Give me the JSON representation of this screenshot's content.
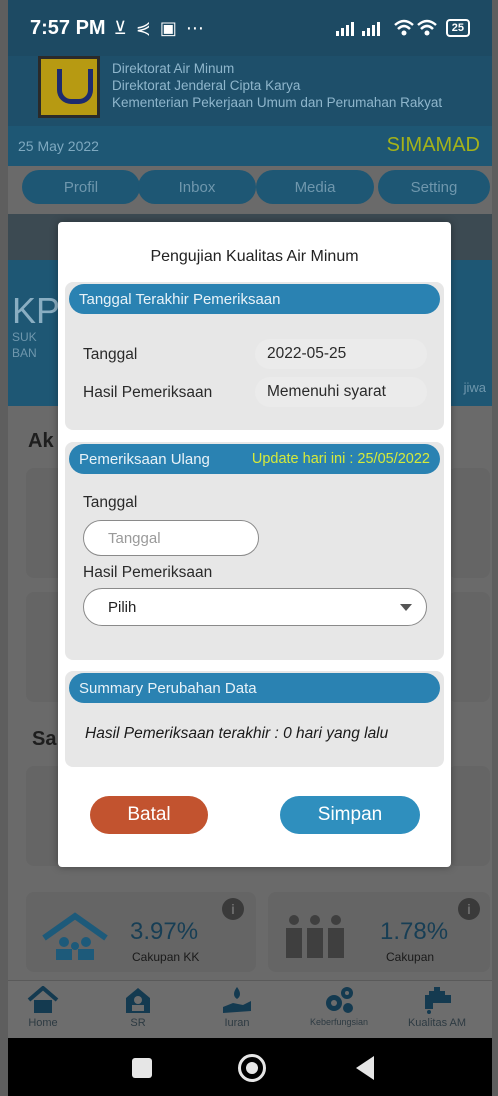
{
  "status_bar": {
    "time": "7:57 PM",
    "left_icons": "⊻ ⋞ ▣ ⋯",
    "battery": "25"
  },
  "header": {
    "org_lines": [
      "Direktorat Air Minum",
      "Direktorat Jenderal Cipta Karya",
      "Kementerian Pekerjaan Umum dan Perumahan Rakyat"
    ],
    "date": "25 May 2022",
    "app_name": "SIMAMAD"
  },
  "menu": {
    "items": [
      "Profil",
      "Inbox",
      "Media",
      "Setting"
    ]
  },
  "background": {
    "info_title": "KP",
    "info_sub1": "SUK",
    "info_sub2": "BAN",
    "info_right": "jiwa",
    "section1": "Ak",
    "section2": "Sa",
    "stat1_value": "3.97%",
    "stat1_label": "Cakupan KK",
    "stat2_value": "1.78%",
    "stat2_label": "Cakupan"
  },
  "modal": {
    "title": "Pengujian Kualitas Air Minum",
    "last_check": {
      "header": "Tanggal Terakhir Pemeriksaan",
      "date_label": "Tanggal",
      "date_value": "2022-05-25",
      "result_label": "Hasil Pemeriksaan",
      "result_value": "Memenuhi syarat"
    },
    "recheck": {
      "header": "Pemeriksaan Ulang",
      "update_note": "Update hari ini : 25/05/2022",
      "date_label": "Tanggal",
      "date_placeholder": "Tanggal",
      "result_label": "Hasil Pemeriksaan",
      "result_selected": "Pilih"
    },
    "summary": {
      "header": "Summary Perubahan Data",
      "text": "Hasil Pemeriksaan terakhir : 0 hari yang lalu"
    },
    "cancel_label": "Batal",
    "save_label": "Simpan"
  },
  "bottom_nav": {
    "items": [
      {
        "label": "Home",
        "icon": "home-icon"
      },
      {
        "label": "SR",
        "icon": "house-user-icon"
      },
      {
        "label": "Iuran",
        "icon": "hand-water-icon"
      },
      {
        "label": "Keberfungsian",
        "icon": "gears-icon"
      },
      {
        "label": "Kualitas AM",
        "icon": "faucet-icon"
      }
    ]
  }
}
